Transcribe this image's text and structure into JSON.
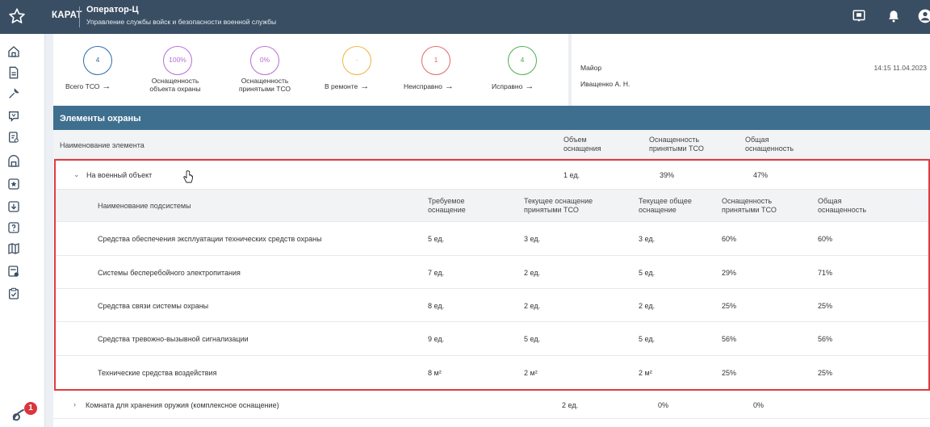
{
  "topbar": {
    "brand": "КАРАТ",
    "title": "Оператор-Ц",
    "subtitle": "Управление службы войск и безопасности военной службы",
    "icons": [
      "star-icon",
      "chat-icon",
      "bell-icon",
      "account-icon"
    ]
  },
  "leftnav": {
    "icons": [
      "home-icon",
      "document-icon",
      "tools-icon",
      "flag-icon",
      "clipboard-icon",
      "building-icon",
      "shield-icon",
      "download-icon",
      "help-icon",
      "map-icon",
      "report-icon",
      "task-icon"
    ],
    "notification_count": "1"
  },
  "stats": [
    {
      "value": "4",
      "label": "Всего ТСО",
      "arrow": "→",
      "color": "#2c6ba8"
    },
    {
      "value": "100%",
      "label": "Оснащенность\nобъекта охраны",
      "arrow": "",
      "color": "#b76ed6"
    },
    {
      "value": "0%",
      "label": "Оснащенность\nпринятыми ТСО",
      "arrow": "",
      "color": "#b76ed6"
    },
    {
      "value": "-",
      "label": "В ремонте",
      "arrow": "→",
      "color": "#f0b43c"
    },
    {
      "value": "1",
      "label": "Неисправно",
      "arrow": "→",
      "color": "#e06a6a"
    },
    {
      "value": "4",
      "label": "Исправно",
      "arrow": "→",
      "color": "#4caf50"
    }
  ],
  "user": {
    "rank": "Майор",
    "name": "Иващенко А. Н.",
    "datetime": "14:15 11.04.2023"
  },
  "panel": {
    "title": "Элементы охраны",
    "columns": {
      "name": "Наименование элемента",
      "volume": "Объем\nоснащения",
      "accepted": "Оснащенность\nпринятыми ТСО",
      "total": "Общая\nоснащенность"
    },
    "group": {
      "name": "На военный объект",
      "volume": "1 ед.",
      "accepted": "39%",
      "total": "47%",
      "subcolumns": {
        "name": "Наименование подсистемы",
        "required": "Требуемое\nоснащение",
        "current_accepted": "Текущее оснащение\nпринятыми ТСО",
        "current_total": "Текущее общее\nоснащение",
        "accepted": "Оснащенность\nпринятыми ТСО",
        "total": "Общая\nоснащенность"
      },
      "rows": [
        {
          "name": "Средства обеспечения эксплуатации технических средств охраны",
          "required": "5 ед.",
          "current_accepted": "3 ед.",
          "current_total": "3 ед.",
          "accepted": "60%",
          "total": "60%"
        },
        {
          "name": "Системы бесперебойного электропитания",
          "required": "7 ед.",
          "current_accepted": "2 ед.",
          "current_total": "5 ед.",
          "accepted": "29%",
          "total": "71%"
        },
        {
          "name": "Средства связи системы охраны",
          "required": "8 ед.",
          "current_accepted": "2 ед.",
          "current_total": "2 ед.",
          "accepted": "25%",
          "total": "25%"
        },
        {
          "name": "Средства тревожно-вызывной сигнализации",
          "required": "9 ед.",
          "current_accepted": "5 ед.",
          "current_total": "5 ед.",
          "accepted": "56%",
          "total": "56%"
        },
        {
          "name": "Технические средства воздействия",
          "required": "8 м²",
          "current_accepted": "2 м²",
          "current_total": "2 м²",
          "accepted": "25%",
          "total": "25%"
        }
      ]
    },
    "collapsed_row": {
      "name": "Комната для хранения оружия (комплексное оснащение)",
      "volume": "2 ед.",
      "accepted": "0%",
      "total": "0%"
    }
  }
}
